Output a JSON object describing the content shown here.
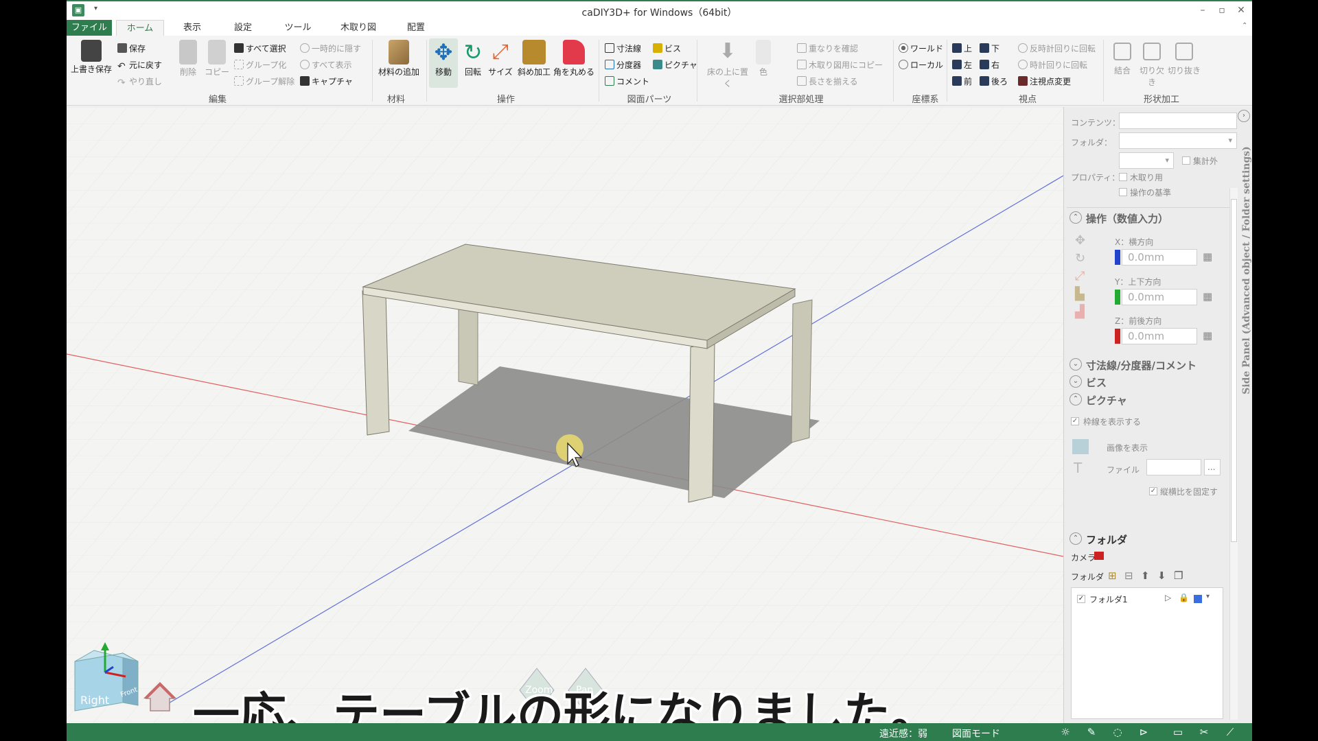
{
  "window": {
    "title": "caDIY3D+ for Windows（64bit）",
    "quick_access": "▾"
  },
  "tabs": [
    "ファイル",
    "ホーム",
    "表示",
    "設定",
    "ツール",
    "木取り図",
    "配置"
  ],
  "ribbon": {
    "edit": {
      "overwrite_save": "上書き保存",
      "save": "保存",
      "undo": "元に戻す",
      "redo": "やり直し",
      "delete": "削除",
      "copy": "コピー",
      "select_all": "すべて選択",
      "group": "グループ化",
      "ungroup": "グループ解除",
      "temp_hide": "一時的に隠す",
      "show_all": "すべて表示",
      "capture": "キャプチャ",
      "group_label": "編集"
    },
    "material": {
      "add_material": "材料の追加",
      "group_label": "材料"
    },
    "operation": {
      "move": "移動",
      "rotate": "回転",
      "size": "サイズ",
      "bevel": "斜め加工",
      "round": "角を丸める",
      "group_label": "操作"
    },
    "drawing_parts": {
      "dimension": "寸法線",
      "screw": "ビス",
      "protractor": "分度器",
      "picture": "ピクチャ",
      "comment": "コメント",
      "group_label": "図面パーツ"
    },
    "selection": {
      "place_on_floor": "床の上に置く",
      "color": "色",
      "check_overlap": "重なりを確認",
      "copy_for_cutting": "木取り図用にコピー",
      "align_length": "長さを揃える",
      "group_label": "選択部処理"
    },
    "coords": {
      "world": "ワールド",
      "local": "ローカル",
      "group_label": "座標系"
    },
    "view": {
      "top": "上",
      "bottom": "下",
      "left": "左",
      "right": "右",
      "front": "前",
      "back": "後ろ",
      "ccw": "反時計回りに回転",
      "cw": "時計回りに回転",
      "change_focus": "注視点変更",
      "group_label": "視点"
    },
    "shape": {
      "join": "結合",
      "notch": "切り欠き",
      "cut": "切り抜き",
      "group_label": "形状加工"
    }
  },
  "side_panel": {
    "content_label": "コンテンツ：",
    "folder_label": "フォルダ：",
    "property_label": "プロパティ：",
    "exclude_count": "集計外",
    "for_cutting": "木取り用",
    "op_base": "操作の基準",
    "op_section": "操作（数値入力）",
    "x_label": "X：横方向",
    "x_value": "0.0mm",
    "y_label": "Y：上下方向",
    "y_value": "0.0mm",
    "z_label": "Z：前後方向",
    "z_value": "0.0mm",
    "dim_section": "寸法線/分度器/コメント",
    "screw_section": "ビス",
    "picture_section": "ピクチャ",
    "show_frame": "枠線を表示する",
    "show_image": "画像を表示",
    "file_label": "ファイル",
    "file_button": "...",
    "keep_ratio": "縦横比を固定す",
    "folder_section": "フォルダ",
    "camera_label": "カメラ",
    "folder_tools_label": "フォルダ",
    "folder_item": "フォルダ1",
    "vertical_title": "Side Panel (Advanced object / Folder settings)"
  },
  "viewport": {
    "subtitle": "一応、テーブルの形になりました。",
    "cube_right": "Right",
    "cube_front": "Front",
    "zoom": "Zoom",
    "pan": "Pan"
  },
  "status": {
    "perspective": "遠近感：弱",
    "mode": "図面モード"
  },
  "colors": {
    "accent": "#2e7d4f",
    "x_axis": "#2244cc",
    "y_axis": "#22aa33",
    "z_axis": "#cc2222",
    "table_top": "#cfcdbb",
    "table_leg": "#d8d6c6"
  }
}
